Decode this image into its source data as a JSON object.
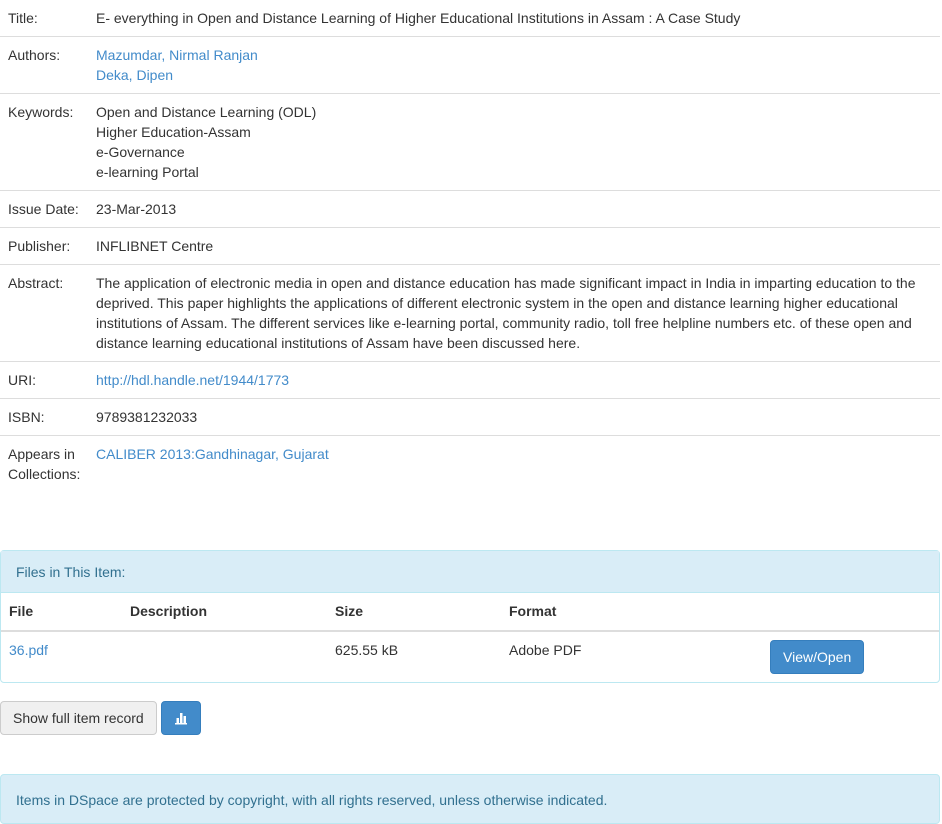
{
  "item": {
    "title_label": "Title:",
    "title": "E- everything in Open and Distance Learning of Higher Educational Institutions in Assam : A Case Study",
    "authors_label": "Authors:",
    "authors": [
      "Mazumdar, Nirmal Ranjan",
      "Deka, Dipen"
    ],
    "keywords_label": "Keywords:",
    "keywords": [
      "Open and Distance Learning (ODL)",
      "Higher Education-Assam",
      "e-Governance",
      "e-learning Portal"
    ],
    "issue_date_label": "Issue Date:",
    "issue_date": "23-Mar-2013",
    "publisher_label": "Publisher:",
    "publisher": "INFLIBNET Centre",
    "abstract_label": "Abstract:",
    "abstract": "The application of electronic media in open and distance education has made significant impact in India in imparting education to the deprived. This paper highlights the applications of different electronic system in the open and distance learning higher educational institutions of Assam. The different services like e-learning portal, community radio, toll free helpline numbers etc. of these open and distance learning educational institutions of Assam have been discussed here.",
    "uri_label": "URI:",
    "uri": "http://hdl.handle.net/1944/1773",
    "isbn_label": "ISBN:",
    "isbn": "9789381232033",
    "collections_label": "Appears in Collections:",
    "collection": "CALIBER 2013:Gandhinagar, Gujarat"
  },
  "files": {
    "heading": "Files in This Item:",
    "columns": [
      "File",
      "Description",
      "Size",
      "Format"
    ],
    "rows": [
      {
        "file": "36.pdf",
        "description": "",
        "size": "625.55 kB",
        "format": "Adobe PDF",
        "action": "View/Open"
      }
    ]
  },
  "actions": {
    "full_record_label": "Show full item record",
    "stats_icon": "bar-chart-icon"
  },
  "footer": {
    "notice": "Items in DSpace are protected by copyright, with all rights reserved, unless otherwise indicated."
  },
  "colors": {
    "link": "#428bca",
    "info_bg": "#d9edf7",
    "info_text": "#31708f",
    "primary_button": "#428bca"
  }
}
